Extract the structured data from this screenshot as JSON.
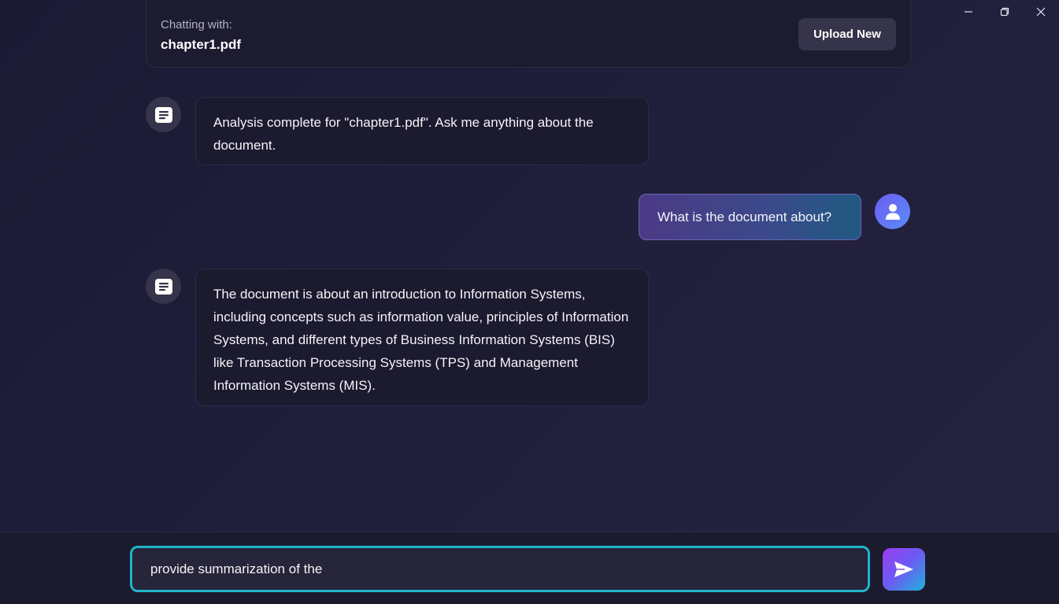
{
  "window": {
    "minimize_icon": "minimize-icon",
    "maximize_icon": "restore-icon",
    "close_icon": "close-icon"
  },
  "header": {
    "chatting_label": "Chatting with:",
    "file_name": "chapter1.pdf",
    "upload_label": "Upload New"
  },
  "messages": [
    {
      "role": "bot",
      "icon": "document-icon",
      "text": "Analysis complete for \"chapter1.pdf\". Ask me anything about the document."
    },
    {
      "role": "user",
      "icon": "user-icon",
      "text": "What is the document about?"
    },
    {
      "role": "bot",
      "icon": "document-icon",
      "text": "The document is about an introduction to Information Systems, including concepts such as information value, principles of Information Systems, and different types of Business Information Systems (BIS) like Transaction Processing Systems (TPS) and Management Information Systems (MIS)."
    }
  ],
  "composer": {
    "value": "provide summarization of the",
    "send_icon": "send-icon"
  },
  "colors": {
    "accent": "#1fb5c9",
    "background": "#201f3c"
  }
}
